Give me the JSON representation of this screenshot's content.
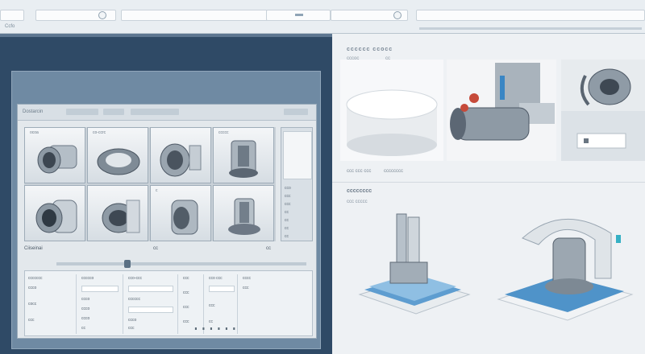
{
  "topbar": {
    "left_text": "Ccfo",
    "mid_text": "",
    "right_text": ""
  },
  "monitor": {
    "toolbar": {
      "left_label": "Dostarcin",
      "tab_a": "",
      "tab_b": ""
    },
    "cells": [
      {
        "title": "ocoa"
      },
      {
        "title": "co-ccrc"
      },
      {
        "title": ""
      },
      {
        "title": "ccccc"
      },
      {
        "title": ""
      },
      {
        "title": ""
      },
      {
        "title": "c"
      },
      {
        "title": ""
      }
    ],
    "side_rows": [
      "cco",
      "ccc",
      "ccc",
      "cc",
      "cc",
      "cc",
      "cc"
    ],
    "status_left": "Ciiseinai",
    "status_mid": "cc",
    "status_right": "cc",
    "lower": {
      "col1": [
        "ccccccc",
        "ccco",
        "cocc",
        "ccc"
      ],
      "col2": [
        "ccccco",
        "ccco",
        "ccco",
        "ccco",
        "cc"
      ],
      "col3": [
        "cco-ccc",
        "cccccc",
        "ccco",
        "ccc"
      ],
      "col4": [
        "ccc",
        "ccc",
        "ccc",
        "ccc"
      ],
      "col5": [
        "cco ccc",
        "ccc",
        "cc"
      ],
      "col6": [
        "cccc",
        "ccc"
      ],
      "toolbar": "∎ ∎ ∎ ∎ ∎ ∎"
    }
  },
  "right": {
    "title": "cccccc ccocc",
    "subtitle": "cccoc",
    "subtitle2": "cc",
    "caption1": "ccc ccc ccc",
    "caption2": "cccccccc",
    "section2_title": "cccccccc",
    "section2_sub": "ccc ccccc"
  },
  "colors": {
    "dark_bg": "#2f4a66",
    "light_bg": "#eef1f4",
    "accent": "#4a90c2"
  }
}
